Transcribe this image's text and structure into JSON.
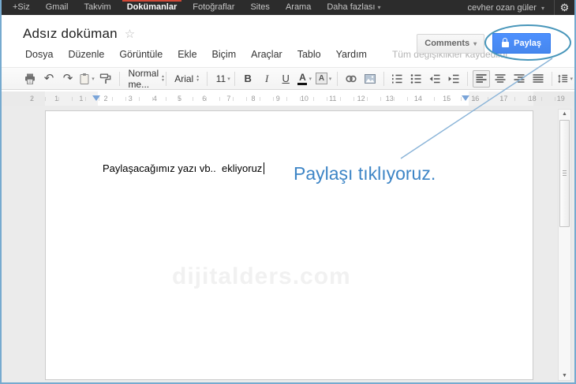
{
  "topbar": {
    "items": [
      "+Siz",
      "Gmail",
      "Takvim",
      "Dokümanlar",
      "Fotoğraflar",
      "Sites",
      "Arama",
      "Daha fazlası"
    ],
    "active_item": "Dokümanlar",
    "user_name": "cevher ozan güler"
  },
  "header": {
    "title": "Adsız doküman",
    "menus": [
      "Dosya",
      "Düzenle",
      "Görüntüle",
      "Ekle",
      "Biçim",
      "Araçlar",
      "Tablo",
      "Yardım"
    ],
    "save_status": "Tüm değişiklikler kaydedildi",
    "comments_label": "Comments",
    "share_label": "Paylaş"
  },
  "toolbar": {
    "paragraph_style": "Normal me...",
    "font_family": "Arial",
    "font_size": "11",
    "bold_label": "B",
    "italic_label": "I",
    "underline_label": "U",
    "text_color_label": "A",
    "highlight_label": "A",
    "icon_names": [
      "print",
      "undo",
      "redo",
      "web-clipboard",
      "paint-format",
      "insert-link",
      "insert-image",
      "numbered-list",
      "bulleted-list",
      "decrease-indent",
      "increase-indent",
      "align-left",
      "align-center",
      "align-right",
      "justify",
      "line-spacing"
    ],
    "selected_alignment": "align-left"
  },
  "ruler": {
    "numbers": [
      "2",
      "1",
      "1",
      "2",
      "3",
      "4",
      "5",
      "6",
      "7",
      "8",
      "9",
      "10",
      "11",
      "12",
      "13",
      "14",
      "15",
      "16",
      "17",
      "18",
      "19"
    ]
  },
  "document": {
    "body_text": "Paylaşacağımız yazı vb..  ekliyoruz",
    "watermark": "dijitalders.com"
  },
  "annotation": {
    "text": "Paylaşı tıklıyoruz."
  },
  "icons": {
    "gear": "⚙",
    "star": "☆",
    "undo": "↶",
    "redo": "↷",
    "caret_down": "▾",
    "caret_up": "▴",
    "scroll_up": "▲",
    "scroll_down": "▼"
  },
  "colors": {
    "topbar_bg": "#2c2c2c",
    "active_indicator_red": "#d14836",
    "share_button_blue": "#4d90fe",
    "annotation_blue": "#3d85c6",
    "callout_ellipse": "#4896ba"
  }
}
